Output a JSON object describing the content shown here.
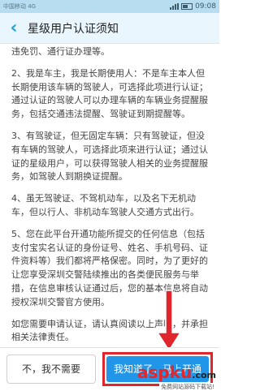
{
  "statusbar": {
    "carrier": "中国移动 4G",
    "time": "09:08"
  },
  "header": {
    "back_icon": "‹",
    "title": "星级用户认证须知"
  },
  "content": {
    "paragraphs": [
      "违免罚、通行证办理等。",
      "2、我是车主，我是长期使用人：不是车主本人但长期使用该车辆的驾驶人，可选择此项进行认证；通过认证的驾驶人可以办理车辆的车辆业务提醒服务，包括交通违法提醒、驾驶证到期提醒等。",
      "3、有驾驶证，但无固定车辆：只有驾驶证，但没有车辆的驾驶人，可选择此项来进行认证；通过认证的星级用户，可以获得驾驶人相关的业务提醒服务，如驾驶人到期换证提醒。",
      "4、虽无驾驶证、不驾机动车，以及名下无机动车，但以行人、非机动车驾驶人交通方式出行。",
      "5、您在此平台开通功能所提交的任何信息（包括支付宝实名认证的身份证号、姓名、手机号码、证件资料等）我们都将严格保密。同时，为了更好的让您享受深圳交警陆续推出的各类便民服务与举措，在信息审核认证通过后，您的基本信息将自动授权深圳交警官方使用。",
      "如您需要申请认证，请认真阅读以上声明，并承担相关法律责任。"
    ]
  },
  "buttons": {
    "decline": "不，我不需要",
    "accept": "我知道了，马上开通"
  },
  "watermark": {
    "logo_main": "aspku",
    "logo_suffix": ".com",
    "tagline": "免费网站源码下载站!"
  },
  "colors": {
    "accent": "#2196e8",
    "highlight": "#e0262c",
    "header_bg": "#e9f6fd"
  }
}
